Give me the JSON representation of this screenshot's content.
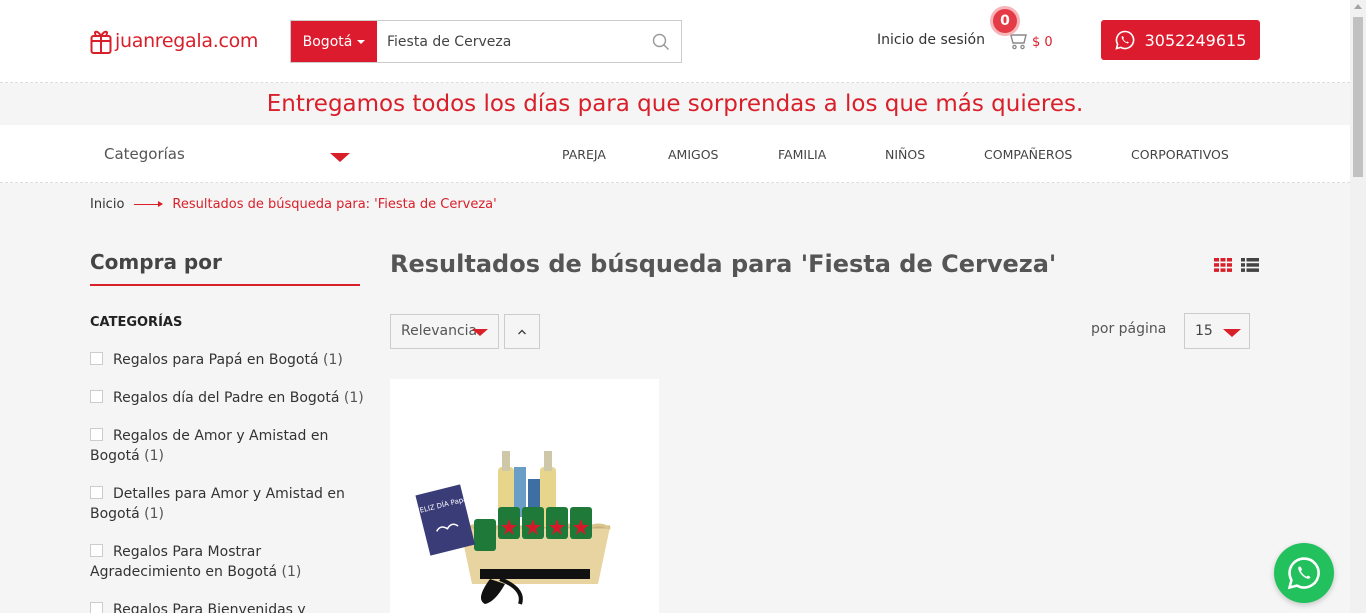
{
  "header": {
    "logo": "juanregala.com",
    "city_label": "Bogotá",
    "search_value": "Fiesta de Cerveza",
    "login_label": "Inicio de sesión",
    "cart_count": "0",
    "cart_total": "$ 0",
    "phone": "3052249615"
  },
  "banner": {
    "text": "Entregamos todos los días para que sorprendas a los que más quieres."
  },
  "nav": {
    "categories_label": "Categorías",
    "links": [
      "PAREJA",
      "AMIGOS",
      "FAMILIA",
      "NIÑOS",
      "COMPAÑEROS",
      "CORPORATIVOS"
    ]
  },
  "breadcrumb": {
    "home": "Inicio",
    "current": "Resultados de búsqueda para: 'Fiesta de Cerveza'"
  },
  "sidebar": {
    "title": "Compra por",
    "section_title": "CATEGORÍAS",
    "filters": [
      {
        "label": "Regalos para Papá en Bogotá",
        "count": "(1)"
      },
      {
        "label": "Regalos día del Padre en Bogotá",
        "count": "(1)"
      },
      {
        "label": "Regalos de Amor y Amistad en Bogotá",
        "count": "(1)"
      },
      {
        "label": "Detalles para Amor y Amistad en Bogotá",
        "count": "(1)"
      },
      {
        "label": "Regalos Para Mostrar Agradecimiento en Bogotá",
        "count": "(1)"
      },
      {
        "label": "Regalos Para Bienvenidas y",
        "count": ""
      }
    ]
  },
  "main": {
    "title": "Resultados de búsqueda para 'Fiesta de Cerveza'",
    "sort_value": "Relevancia",
    "per_page_label": "por página",
    "per_page_value": "15"
  },
  "product": {
    "card_text": "FELIZ DÍA Papá"
  },
  "colors": {
    "brand_red": "#dc1c2e",
    "whatsapp_green": "#22c15e"
  }
}
